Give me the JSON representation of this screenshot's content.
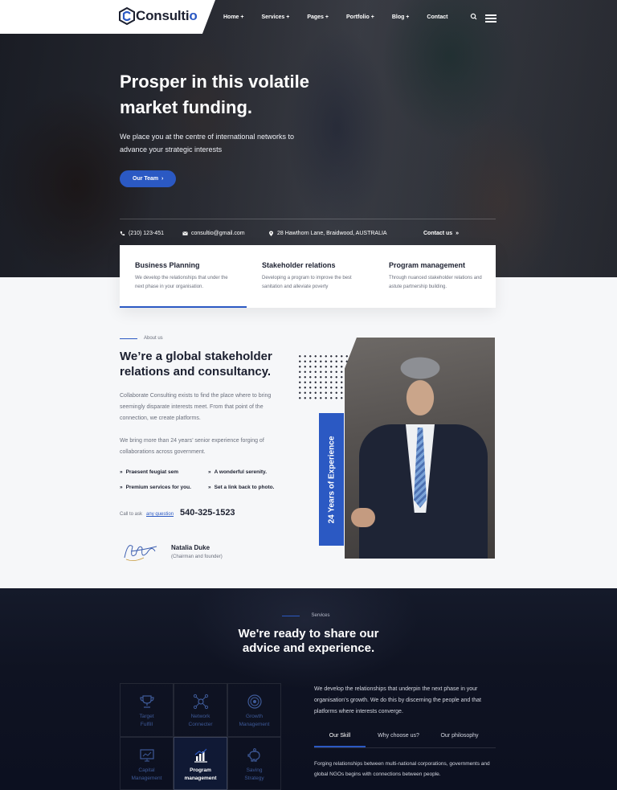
{
  "header": {
    "logo_text": "Consulti",
    "logo_text_accent": "o",
    "nav": [
      "Home +",
      "Services +",
      "Pages +",
      "Portfolio +",
      "Blog +",
      "Contact"
    ]
  },
  "hero": {
    "title": "Prosper in this volatile market funding.",
    "subtitle": "We place you at the centre of international networks to advance your strategic interests",
    "cta": "Our Team"
  },
  "contact": {
    "phone": "(210) 123-451",
    "email": "consultio@gmail.com",
    "address": "28 Hawthorn Lane, Braidwood, AUSTRALIA",
    "contact_link": "Contact us"
  },
  "cards": [
    {
      "title": "Business Planning",
      "text": "We develop the relationships that under the next phase in your organisation."
    },
    {
      "title": "Stakeholder relations",
      "text": "Developing a program to improve the best sanitation and alleviate poverty"
    },
    {
      "title": "Program management",
      "text": "Through nuanced stakeholder relations and astute partnership building."
    }
  ],
  "about": {
    "eyebrow": "About us",
    "title": "We’re a global stakeholder relations and consultancy.",
    "p1": "Collaborate Consulting exists to find the place where to bring seemingly disparate interests meet. From that point of the connection, we create platforms.",
    "p2": "We bring more than 24 years’ senior experience forging of collaborations across government.",
    "features": [
      "Praesent feugiat sem",
      "A wonderful serenity.",
      "Premium services for you.",
      "Set a link back to photo."
    ],
    "call_prefix": "Call to ask",
    "call_link": "any question",
    "phone": "540-325-1523",
    "sig_name": "Natalia Duke",
    "sig_role": "(Chairman and founder)",
    "experience": "24 Years of Experience"
  },
  "services": {
    "eyebrow": "Services",
    "title_line1": "We're ready to share our",
    "title_line2": "advice and experience.",
    "grid": [
      {
        "label1": "Target",
        "label2": "Fulfill",
        "icon": "trophy-icon"
      },
      {
        "label1": "Network",
        "label2": "Connecter",
        "icon": "network-icon"
      },
      {
        "label1": "Growth",
        "label2": "Management",
        "icon": "target-icon"
      },
      {
        "label1": "Capital",
        "label2": "Management",
        "icon": "monitor-chart-icon"
      },
      {
        "label1": "Program",
        "label2": "management",
        "icon": "bar-chart-icon"
      },
      {
        "label1": "Saving",
        "label2": "Strategy",
        "icon": "piggy-icon"
      }
    ],
    "text": "We develop the relationships that underpin the next phase in your organisation’s growth. We do this by discerning the people and that platforms where interests converge.",
    "tabs": [
      "Our Skill",
      "Why choose us?",
      "Our philosophy"
    ],
    "tab_text": "Forging relationships between multi-national corporations, governments and global NGOs begins with connections between people."
  },
  "colors": {
    "accent": "#2b59c3",
    "dark": "#0f1322"
  }
}
